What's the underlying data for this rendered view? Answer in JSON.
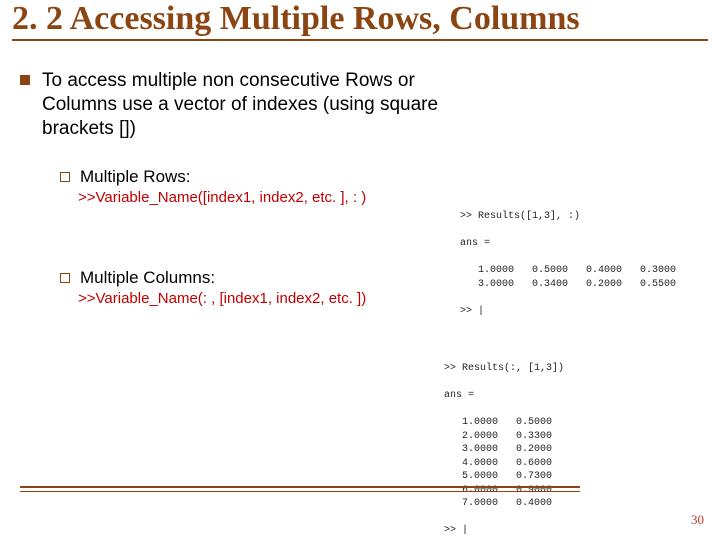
{
  "title": "2. 2 Accessing Multiple Rows, Columns",
  "intro": "To access multiple non consecutive Rows or Columns use a vector of indexes (using square brackets [])",
  "sub1": {
    "label": "Multiple Rows:",
    "cmd": ">>Variable_Name([index1, index2, etc. ], : )"
  },
  "sub2": {
    "label": "Multiple Columns:",
    "cmd": ">>Variable_Name(: , [index1, index2, etc. ])"
  },
  "matlab1": ">> Results([1,3], :)\n\nans =\n\n   1.0000   0.5000   0.4000   0.3000\n   3.0000   0.3400   0.2000   0.5500\n\n>> |",
  "matlab2": ">> Results(:, [1,3])\n\nans =\n\n   1.0000   0.5000\n   2.0000   0.3300\n   3.0000   0.2000\n   4.0000   0.6000\n   5.0000   0.7300\n   6.0000   0.9000\n   7.0000   0.4000\n\n>> |",
  "page": "30"
}
